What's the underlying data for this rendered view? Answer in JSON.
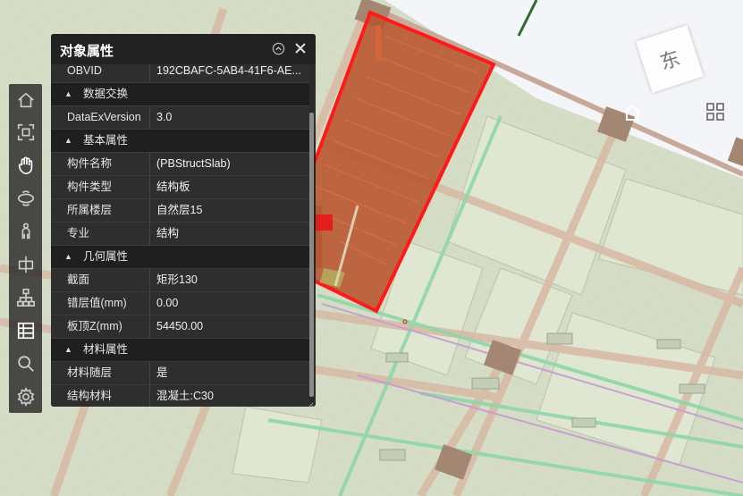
{
  "panel": {
    "title": "对象属性",
    "rows": [
      {
        "type": "prop",
        "key": "OBVID",
        "value": "192CBAFC-5AB4-41F6-AE..."
      },
      {
        "type": "section",
        "label": "数据交换"
      },
      {
        "type": "prop",
        "key": "DataExVersion",
        "value": "3.0"
      },
      {
        "type": "section",
        "label": "基本属性"
      },
      {
        "type": "prop",
        "key": "构件名称",
        "value": "(PBStructSlab)"
      },
      {
        "type": "prop",
        "key": "构件类型",
        "value": "结构板"
      },
      {
        "type": "prop",
        "key": "所属楼层",
        "value": "自然层15"
      },
      {
        "type": "prop",
        "key": "专业",
        "value": "结构"
      },
      {
        "type": "section",
        "label": "几何属性"
      },
      {
        "type": "prop",
        "key": "截面",
        "value": "矩形130"
      },
      {
        "type": "prop",
        "key": "错层值(mm)",
        "value": "0.00"
      },
      {
        "type": "prop",
        "key": "板顶Z(mm)",
        "value": "54450.00"
      },
      {
        "type": "section",
        "label": "材料属性"
      },
      {
        "type": "prop",
        "key": "材料随层",
        "value": "是"
      },
      {
        "type": "prop",
        "key": "结构材料",
        "value": "混凝土:C30"
      }
    ]
  },
  "toolbar": {
    "tools": [
      {
        "name": "home-icon"
      },
      {
        "name": "fit-view-icon"
      },
      {
        "name": "pan-hand-icon"
      },
      {
        "name": "orbit-icon"
      },
      {
        "name": "walk-person-icon"
      },
      {
        "name": "section-cut-icon"
      },
      {
        "name": "model-tree-icon"
      },
      {
        "name": "property-list-icon"
      },
      {
        "name": "search-icon"
      },
      {
        "name": "settings-gear-icon"
      }
    ]
  },
  "compass": {
    "label": "东"
  },
  "colors": {
    "selection_fill": "#b8542e",
    "selection_outline": "#ff1a1a",
    "panel_bg": "#2e2e2e",
    "ground": "#d4dcc4"
  }
}
